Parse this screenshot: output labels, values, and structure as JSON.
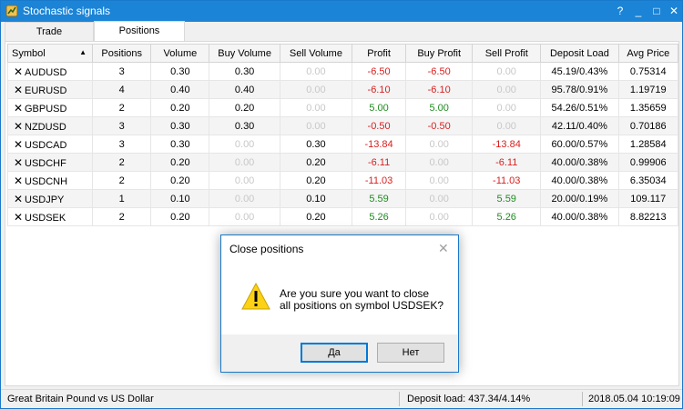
{
  "window": {
    "title": "Stochastic signals",
    "controls": {
      "help": "?",
      "minimize": "_",
      "maximize": "□",
      "close": "✕"
    }
  },
  "tabs": [
    {
      "label": "Trade",
      "active": false
    },
    {
      "label": "Positions",
      "active": true
    }
  ],
  "table": {
    "columns": [
      "Symbol",
      "Positions",
      "Volume",
      "Buy Volume",
      "Sell Volume",
      "Profit",
      "Buy Profit",
      "Sell Profit",
      "Deposit Load",
      "Avg Price"
    ],
    "sort": {
      "column": "Symbol",
      "direction": "ascending"
    },
    "rows": [
      [
        "AUDUSD",
        "3",
        "0.30",
        "0.30",
        "0.00",
        "-6.50",
        "-6.50",
        "0.00",
        "45.19/0.43%",
        "0.75314"
      ],
      [
        "EURUSD",
        "4",
        "0.40",
        "0.40",
        "0.00",
        "-6.10",
        "-6.10",
        "0.00",
        "95.78/0.91%",
        "1.19719"
      ],
      [
        "GBPUSD",
        "2",
        "0.20",
        "0.20",
        "0.00",
        "5.00",
        "5.00",
        "0.00",
        "54.26/0.51%",
        "1.35659"
      ],
      [
        "NZDUSD",
        "3",
        "0.30",
        "0.30",
        "0.00",
        "-0.50",
        "-0.50",
        "0.00",
        "42.11/0.40%",
        "0.70186"
      ],
      [
        "USDCAD",
        "3",
        "0.30",
        "0.00",
        "0.30",
        "-13.84",
        "0.00",
        "-13.84",
        "60.00/0.57%",
        "1.28584"
      ],
      [
        "USDCHF",
        "2",
        "0.20",
        "0.00",
        "0.20",
        "-6.11",
        "0.00",
        "-6.11",
        "40.00/0.38%",
        "0.99906"
      ],
      [
        "USDCNH",
        "2",
        "0.20",
        "0.00",
        "0.20",
        "-11.03",
        "0.00",
        "-11.03",
        "40.00/0.38%",
        "6.35034"
      ],
      [
        "USDJPY",
        "1",
        "0.10",
        "0.00",
        "0.10",
        "5.59",
        "0.00",
        "5.59",
        "20.00/0.19%",
        "109.117"
      ],
      [
        "USDSEK",
        "2",
        "0.20",
        "0.00",
        "0.20",
        "5.26",
        "0.00",
        "5.26",
        "40.00/0.38%",
        "8.82213"
      ]
    ]
  },
  "status": {
    "symbol_description": "Great Britain Pound vs US Dollar",
    "deposit_load": "Deposit load: 437.34/4.14%",
    "datetime": "2018.05.04 10:19:09"
  },
  "dialog": {
    "title": "Close positions",
    "message_line1": "Are you sure you want to close",
    "message_line2": "all positions on symbol USDSEK?",
    "yes_label": "Да",
    "no_label": "Нет"
  },
  "colors": {
    "titlebar": "#1b84d6",
    "negative": "#d91e1e",
    "positive": "#1f8c1f",
    "zero": "#c8c8c8"
  }
}
